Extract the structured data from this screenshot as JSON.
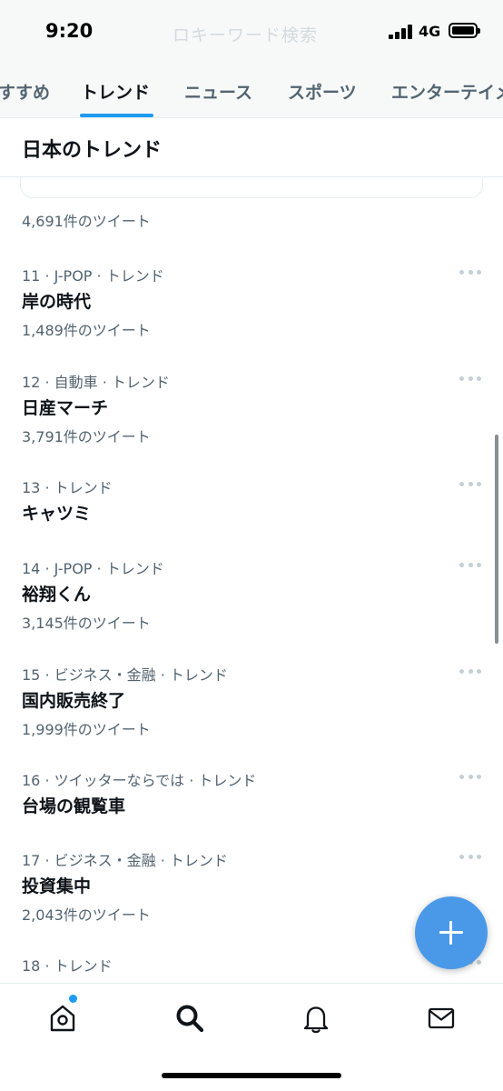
{
  "status_bar": {
    "time": "9:20",
    "network": "4G",
    "search_ghost_text": "ロキーワード検索"
  },
  "tabs": [
    {
      "label": "すすめ"
    },
    {
      "label": "トレンド"
    },
    {
      "label": "ニュース"
    },
    {
      "label": "スポーツ"
    },
    {
      "label": "エンターテイメ"
    }
  ],
  "active_tab": "トレンド",
  "section": {
    "title": "日本のトレンド"
  },
  "previous_tweet_count": "4,691件のツイート",
  "trends": [
    {
      "meta": "11 · J-POP · トレンド",
      "name": "岸の時代",
      "count": "1,489件のツイート"
    },
    {
      "meta": "12 · 自動車 · トレンド",
      "name": "日産マーチ",
      "count": "3,791件のツイート"
    },
    {
      "meta": "13 · トレンド",
      "name": "キャツミ",
      "count": ""
    },
    {
      "meta": "14 · J-POP · トレンド",
      "name": "裕翔くん",
      "count": "3,145件のツイート"
    },
    {
      "meta": "15 · ビジネス・金融 · トレンド",
      "name": "国内販売終了",
      "count": "1,999件のツイート"
    },
    {
      "meta": "16 · ツイッターならでは · トレンド",
      "name": "台場の観覧車",
      "count": ""
    },
    {
      "meta": "17 · ビジネス・金融 · トレンド",
      "name": "投資集中",
      "count": "2,043件のツイート"
    },
    {
      "meta": "18 · トレンド",
      "name": "",
      "count": ""
    }
  ],
  "bottom_nav": [
    {
      "icon": "home-icon"
    },
    {
      "icon": "search-icon"
    },
    {
      "icon": "bell-icon"
    },
    {
      "icon": "mail-icon"
    }
  ],
  "fab": {
    "icon": "plus-icon"
  },
  "colors": {
    "accent": "#1d9bf0",
    "fab": "#4a99e9",
    "secondary_text": "#536471",
    "primary_text": "#0f1419"
  }
}
